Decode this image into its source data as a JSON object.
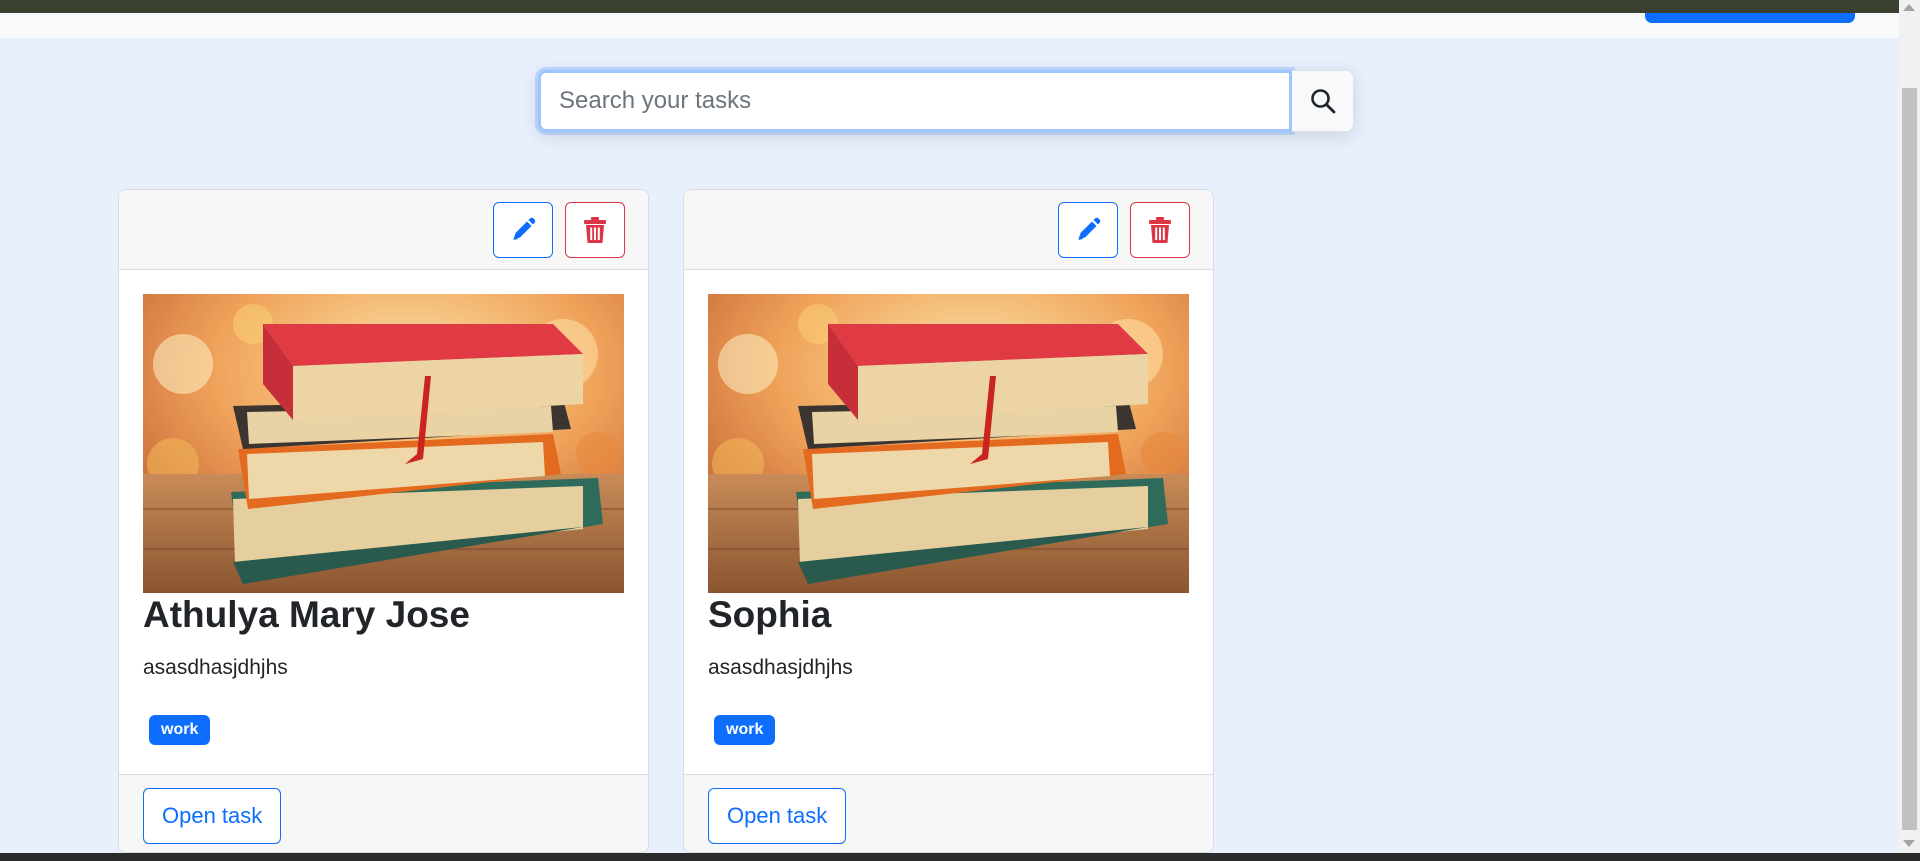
{
  "search": {
    "placeholder": "Search your tasks",
    "value": ""
  },
  "tasks": [
    {
      "title": "Athulya Mary Jose",
      "description": "asasdhasjdhjhs",
      "tag": "work",
      "open_label": "Open task"
    },
    {
      "title": "Sophia",
      "description": "asasdhasjdhjhs",
      "tag": "work",
      "open_label": "Open task"
    }
  ],
  "colors": {
    "primary": "#0d6efd",
    "danger": "#dc3545",
    "page_background": "#e8effd",
    "header_background": "#f7f7f7"
  },
  "icons": {
    "search": "search-icon",
    "edit": "pencil-icon",
    "delete": "trash-icon"
  }
}
